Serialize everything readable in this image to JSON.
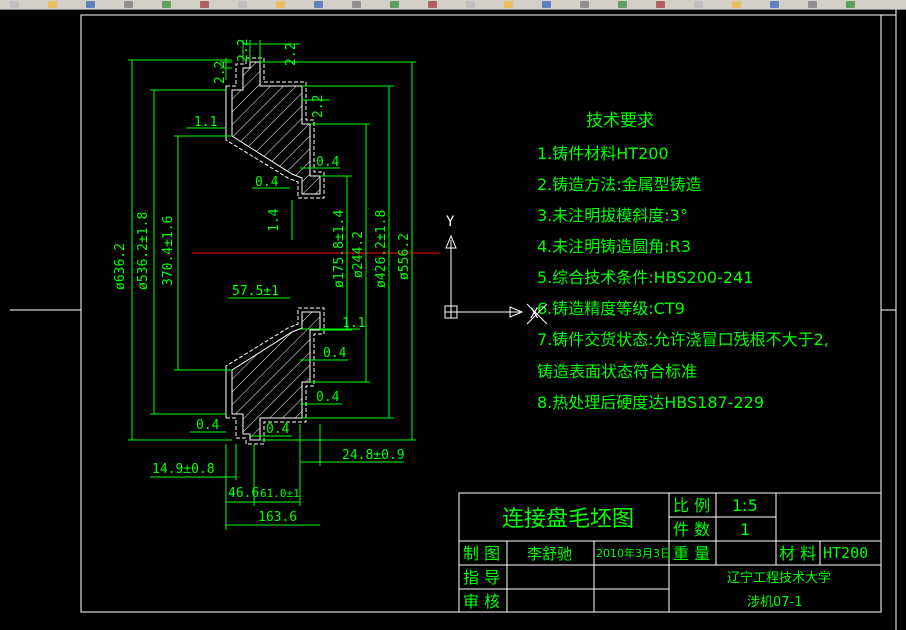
{
  "toolbar": {
    "buttons": [
      "new-icon",
      "open-icon",
      "save-icon",
      "print-icon",
      "preview-icon",
      "plot-icon",
      "cut-icon",
      "copy-icon",
      "paste-icon",
      "match-icon",
      "undo-icon",
      "redo-icon",
      "pan-icon",
      "zoom-icon",
      "zoom-window-icon",
      "zoom-previous-icon",
      "properties-icon",
      "design-center-icon",
      "tool-palettes-icon",
      "sheet-set-icon",
      "markup-icon",
      "calculator-icon",
      "help-icon"
    ]
  },
  "colors": {
    "background": "#000000",
    "frame": "#ffffff",
    "geometry": "#ffffff",
    "hatch": "#ffffff",
    "dimension": "#00ff00",
    "text": "#00ff00",
    "centerline": "#ff0000",
    "ucs": "#ffffff"
  },
  "ucs": {
    "y_label": "Y",
    "x_label": "X"
  },
  "dimensions": {
    "d_636": "ø636.2",
    "d_536": "ø536.2±1.8",
    "d_370": "370.4±1.6",
    "d_175": "ø175.8±1.4",
    "d_244": "ø244.2",
    "d_426": "ø426.2±1.8",
    "d_556": "ø556.2",
    "top_2_2_a": "2.2",
    "top_2_2_b": "2.2",
    "top_2_2_c": "2.2",
    "top_2_2_d": "2.2",
    "d_1_1_top": "1.1",
    "d_0_4_a": "0.4",
    "d_0_4_b": "0.4",
    "d_1_4": "1.4",
    "d_57_5": "57.5±1",
    "d_1_1_bot": "1.1",
    "d_0_4_c": "0.4",
    "d_0_4_d": "0.4",
    "d_0_4_e": "0.4",
    "d_0_4_f": "0.4",
    "d_24_8": "24.8±0.9",
    "d_14_9": "14.9±0.8",
    "d_46_6": "46.6",
    "d_61_0": "61.0±1",
    "d_163_6": "163.6"
  },
  "requirements": {
    "title": "技术要求",
    "items": [
      "1.铸件材料HT200",
      "2.铸造方法:金属型铸造",
      "3.未注明拔模斜度:3°",
      "4.未注明铸造圆角:R3",
      "5.综合技术条件:HBS200-241",
      "6.铸造精度等级:CT9",
      "7.铸件交货状态:允许浇冒口残根不大于2,",
      "铸造表面状态符合标准",
      "8.热处理后硬度达HBS187-229"
    ]
  },
  "title_block": {
    "drawing_title": "连接盘毛坯图",
    "scale_label": "比 例",
    "scale_value": "1:5",
    "qty_label": "件 数",
    "qty_value": "1",
    "weight_label": "重 量",
    "material_label": "材 料",
    "material_value": "HT200",
    "drawn_label": "制 图",
    "drawn_name": "李舒驰",
    "drawn_date": "2010年3月3日",
    "guide_label": "指 导",
    "review_label": "审 核",
    "school": "辽宁工程技术大学",
    "class": "涉机07-1"
  }
}
